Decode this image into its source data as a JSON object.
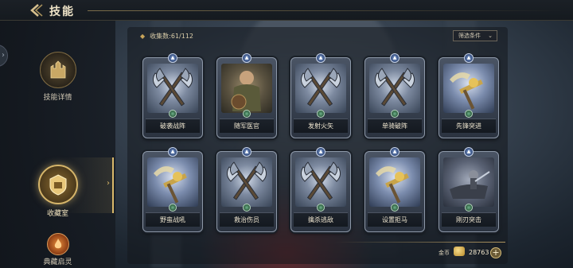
{
  "header": {
    "title": "技能",
    "back_icon": "back-arrow-icon"
  },
  "sidebar": {
    "items": [
      {
        "label": "技能详情",
        "icon": "castle-icon"
      },
      {
        "label": "收藏室",
        "icon": "collection-crest-icon",
        "active": true
      },
      {
        "label": "典藏启灵",
        "icon": "spirit-flame-icon"
      }
    ]
  },
  "collection": {
    "count_label": "收集数:61/112"
  },
  "filter": {
    "label": "筛选条件"
  },
  "cards": [
    {
      "name": "破袭战阵",
      "art": "crossed-axes"
    },
    {
      "name": "随军医官",
      "art": "medic-officer"
    },
    {
      "name": "发射火矢",
      "art": "crossed-axes"
    },
    {
      "name": "单骑破阵",
      "art": "crossed-axes"
    },
    {
      "name": "先锋突进",
      "art": "winged-hammer"
    },
    {
      "name": "野蛮战吼",
      "art": "winged-hammer"
    },
    {
      "name": "救治伤员",
      "art": "crossed-axes"
    },
    {
      "name": "擒杀逃敌",
      "art": "crossed-axes"
    },
    {
      "name": "设置拒马",
      "art": "winged-hammer"
    },
    {
      "name": "刚刃突击",
      "art": "blade-charge"
    }
  ],
  "currency": {
    "label": "金币",
    "value": "28763",
    "icon": "gold-coin-icon"
  },
  "colors": {
    "accent_gold": "#d9b86a",
    "card_frame": "#8d98a8"
  }
}
